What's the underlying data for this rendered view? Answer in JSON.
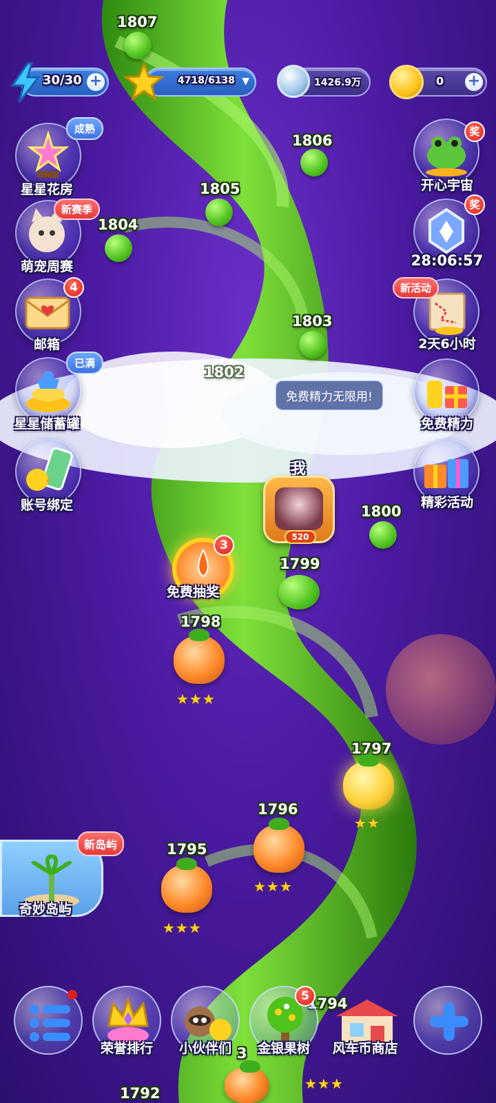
{
  "resources": {
    "energy": "30/30",
    "stars": "4718/6138",
    "coins": "1426.9万",
    "tokens": "0"
  },
  "levels": {
    "l1807": "1807",
    "l1806": "1806",
    "l1805": "1805",
    "l1804": "1804",
    "l1803": "1803",
    "l1802": "1802",
    "l1800": "1800",
    "l1799": "1799",
    "l1798": "1798",
    "l1797": "1797",
    "l1796": "1796",
    "l1795": "1795",
    "l1794": "1794",
    "l1793": "3",
    "l1792": "1792"
  },
  "left_menu": {
    "flower_house": "星星花房",
    "flower_house_tag": "成熟",
    "pet_week": "萌宠周赛",
    "pet_week_tag": "赛季",
    "pet_week_new": "新",
    "mailbox": "邮箱",
    "mailbox_badge": "4",
    "piggy": "星星储蓄罐",
    "piggy_tag": "已满",
    "account": "账号绑定"
  },
  "right_menu": {
    "happy_universe": "开心宇宙",
    "reward_tag": "奖",
    "timer": "28:06:57",
    "event_new": "新",
    "event_tag": "活动",
    "event_time": "2天6小时",
    "free_energy": "免费精力",
    "free_energy_tip": "免费精力无限用!",
    "activities": "精彩活动"
  },
  "player": {
    "me_label": "我",
    "frame_number": "520"
  },
  "lottery": {
    "label": "免费抽奖",
    "badge": "3"
  },
  "island": {
    "label": "奇妙岛屿",
    "tag": "新岛屿"
  },
  "bottom_bar": {
    "honor": "荣誉排行",
    "partners": "小伙伴们",
    "tree": "金银果树",
    "tree_badge": "5",
    "shop": "风车币商店"
  },
  "stars": {
    "s1798": "★★★",
    "s1797": "★★",
    "s1796": "★★★",
    "s1795": "★★★",
    "s1794": "★★★"
  },
  "colors": {
    "background": "#4a1aa0",
    "vine": "#4fc21e",
    "badge": "#e0211a",
    "star": "#ffd21f"
  }
}
